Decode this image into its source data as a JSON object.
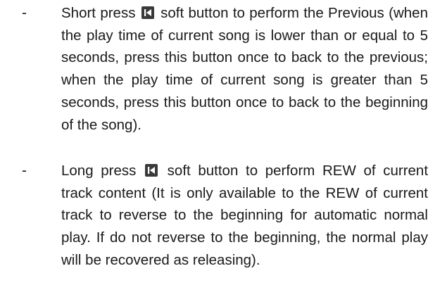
{
  "items": [
    {
      "dash": "-",
      "before_icon": "Short press ",
      "icon": "previous-track-icon",
      "after_icon": " soft button to perform the Previous (when the play time of current song is lower than or equal to 5 seconds, press this button once to back to the previous; when the play time of current song is greater than 5 seconds, press this button once to back to the beginning of the song)."
    },
    {
      "dash": "-",
      "before_icon": "Long press ",
      "icon": "previous-track-icon",
      "after_icon": " soft button to perform REW of current track content (It is only available to the REW of current track to reverse to the beginning for automatic normal play. If do not reverse to the beginning, the normal play will be recovered as releasing)."
    }
  ]
}
